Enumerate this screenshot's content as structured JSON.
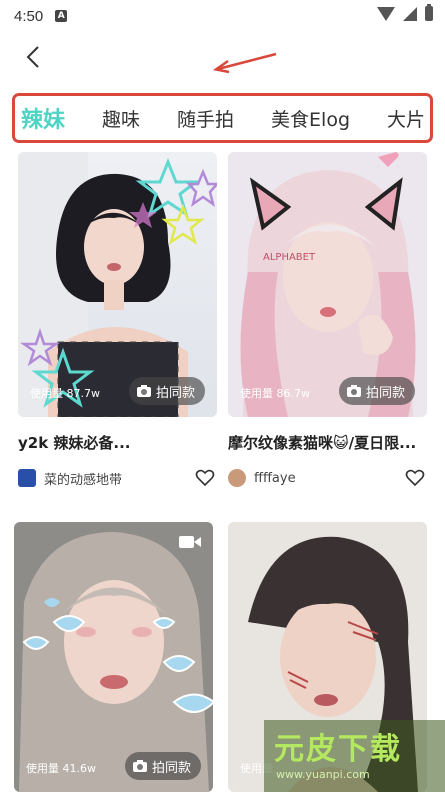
{
  "status_bar": {
    "time": "4:50",
    "notif": "A"
  },
  "tabs": [
    {
      "label": "辣妹",
      "active": true
    },
    {
      "label": "趣味"
    },
    {
      "label": "随手拍"
    },
    {
      "label": "美食Elog"
    },
    {
      "label": "大片"
    }
  ],
  "cards": [
    {
      "title": "y2k 辣妹必备...",
      "author": "菜的动感地带",
      "usage": "使用量 87.7w",
      "button": "拍同款"
    },
    {
      "title": "摩尔纹像素猫咪😺/夏日限...",
      "author": "ffffaye",
      "usage": "使用量 86.7w",
      "button": "拍同款"
    },
    {
      "title": "",
      "author": "",
      "usage": "使用量 41.6w",
      "button": "拍同款"
    },
    {
      "title": "",
      "author": "",
      "usage": "使用量",
      "button": ""
    }
  ],
  "watermark": {
    "logo": "元皮下载",
    "url": "www.yuanpi.com"
  },
  "colors": {
    "accent": "#4fd3c4",
    "annotation": "#d9483b"
  }
}
